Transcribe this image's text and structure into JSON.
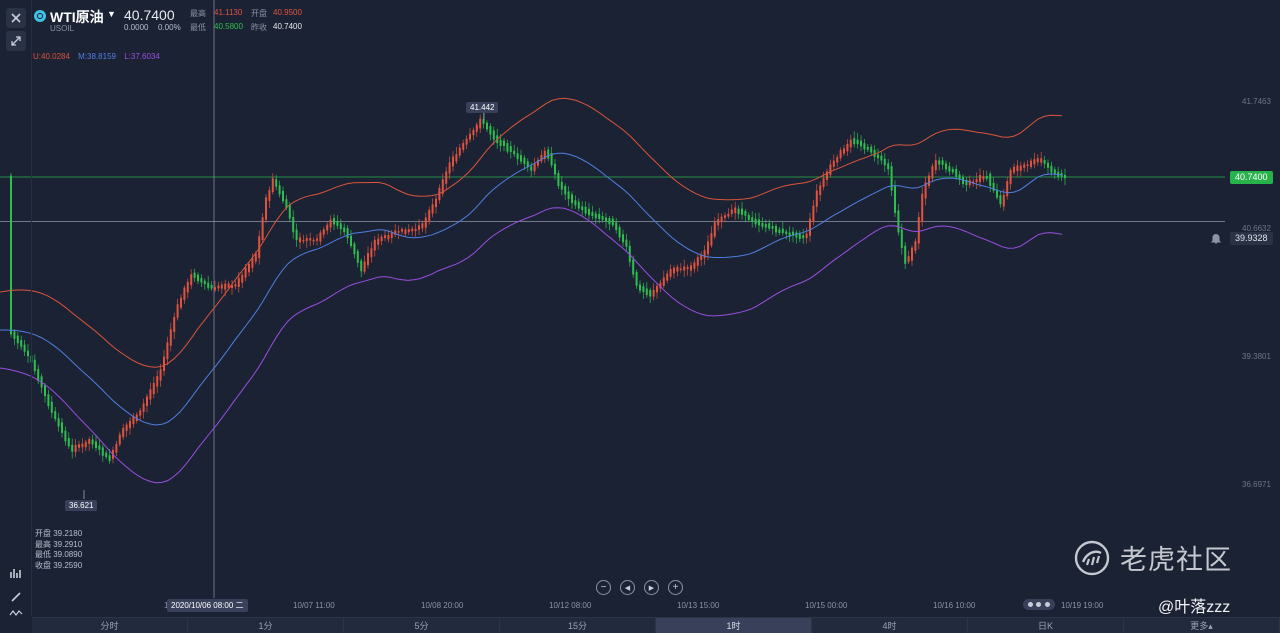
{
  "header": {
    "symbol_name": "WTI原油",
    "symbol_code": "USOIL",
    "price": "40.7400",
    "change": "0.0000",
    "change_pct": "0.00%",
    "stats": {
      "high_label": "最高",
      "high": "41.1130",
      "open_label": "开盘",
      "open": "40.9500",
      "low_label": "最低",
      "low": "40.5800",
      "prev_label": "昨收",
      "prev": "40.7400"
    }
  },
  "indicator": {
    "upper": "U:40.0284",
    "middle": "M:38.8159",
    "lower": "L:37.6034"
  },
  "ohlc_box": {
    "open": "开盘 39.2180",
    "high": "最高 39.2910",
    "low": "最低 39.0890",
    "close": "收盘 39.2590"
  },
  "price_axis": [
    "41.7463",
    "40.6632",
    "39.3801",
    "36.6971"
  ],
  "price_tags": {
    "current": "40.7400",
    "crosshair": "39.9328"
  },
  "annotations": {
    "high_marker": "41.442",
    "low_marker": "36.621"
  },
  "time_axis": {
    "current": "2020/10/06 08:00 二",
    "left_edge": "1",
    "labels": [
      "10/07 11:00",
      "10/08 20:00",
      "10/12 08:00",
      "10/13 15:00",
      "10/15 00:00",
      "10/16 10:00",
      "10/19 19:00"
    ]
  },
  "periods": [
    "分时",
    "1分",
    "5分",
    "15分",
    "1时",
    "4时",
    "日K",
    "更多▴"
  ],
  "active_period": "1时",
  "watermark": {
    "brand": "老虎社区",
    "user": "@叶落zzz"
  },
  "colors": {
    "background": "#1b2234",
    "up": "#e2533f",
    "down": "#2fbf4e",
    "upper_band": "#d8553a",
    "middle_band": "#4f7fe0",
    "lower_band": "#9a4ee0",
    "current_price": "#27b24a"
  },
  "chart_data": {
    "type": "candlestick",
    "series": [
      {
        "name": "U:40.0284",
        "role": "upper_band"
      },
      {
        "name": "M:38.8159",
        "role": "middle_band"
      },
      {
        "name": "L:37.6034",
        "role": "lower_band"
      }
    ],
    "current_price": 40.74,
    "crosshair_price": 39.9328,
    "period_high": 41.442,
    "period_low": 36.621
  }
}
